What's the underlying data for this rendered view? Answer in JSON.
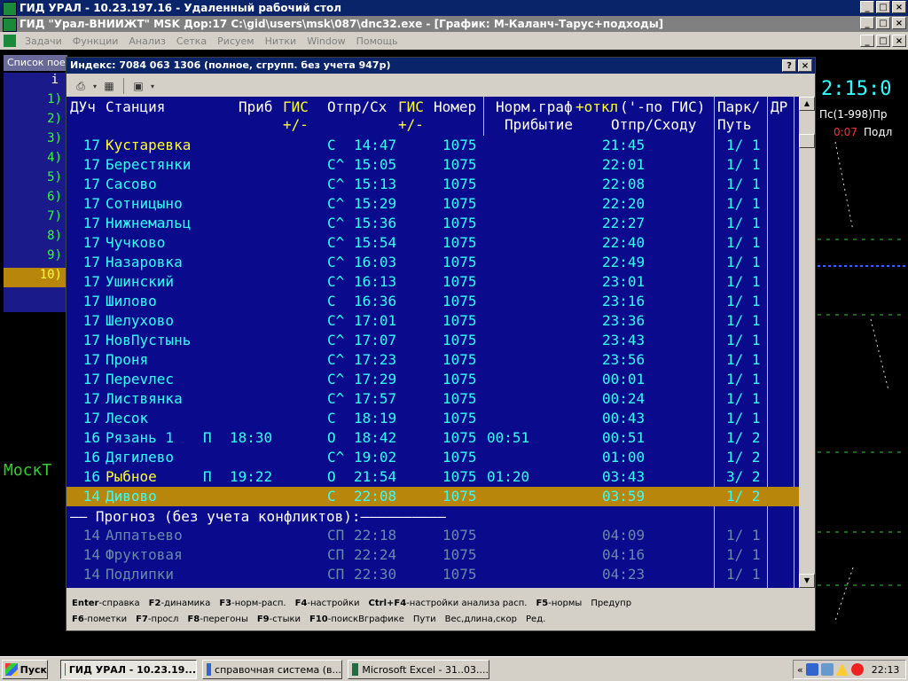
{
  "remote_title": "ГИД УРАЛ - 10.23.197.16 - Удаленный рабочий стол",
  "app_title": "ГИД \"Урал-ВНИИЖТ\" MSK Дор:17 C:\\gid\\users\\msk\\087\\dnc32.exe - [График: М-Каланч-Тарус+подходы]",
  "menu": [
    "Задачи",
    "Функции",
    "Анализ",
    "Сетка",
    "Рисуем",
    "Нитки",
    "Window",
    "Помощь"
  ],
  "window_buttons": {
    "min": "_",
    "max": "□",
    "close": "×"
  },
  "bg_list": {
    "title": "Список пое",
    "header": "i",
    "rows": [
      "1)",
      "2)",
      "3)",
      "4)",
      "5)",
      "6)",
      "7)",
      "8)",
      "9)",
      "10)"
    ]
  },
  "bg_clock": "2:15:0",
  "bg_side": {
    "line1": "Пс(1-998)Пр",
    "red_time": "0:07",
    "line2": "Подл"
  },
  "bg_label": "МоскТ",
  "dialog": {
    "title": "Индекс: 7084 063 1306 (полное, сгрупп. без учета 947р)",
    "help_btn": "?",
    "close_btn": "×"
  },
  "table": {
    "headers": {
      "du": "ДУч",
      "station": "Станция",
      "arr": "Приб",
      "gis1": "ГИС",
      "gis1b": "+/-",
      "dep": "Отпр/Сх",
      "gis2": "ГИС",
      "gis2b": "+/-",
      "num": "Номер",
      "norm": "Норм.граф",
      "otkl": "+откл",
      "pgis": "('-по ГИС)",
      "norm_arr": "Прибытие",
      "norm_dep": "Отпр/Сходу",
      "park": "Парк/",
      "put": "Путь",
      "dr": "ДР"
    },
    "rows": [
      {
        "du": "17",
        "st": "Кустаревка",
        "yel": true,
        "pr": "",
        "pt": "",
        "s": "С",
        "ot": "14:47",
        "num": "1075",
        "arr": "",
        "dep": "21:45",
        "park": "1/ 1"
      },
      {
        "du": "17",
        "st": "Берестянки",
        "yel": false,
        "pr": "",
        "pt": "",
        "s": "С^",
        "ot": "15:05",
        "num": "1075",
        "arr": "",
        "dep": "22:01",
        "park": "1/ 1"
      },
      {
        "du": "17",
        "st": "Сасово",
        "yel": false,
        "pr": "",
        "pt": "",
        "s": "С^",
        "ot": "15:13",
        "num": "1075",
        "arr": "",
        "dep": "22:08",
        "park": "1/ 1"
      },
      {
        "du": "17",
        "st": "Сотницыно",
        "yel": false,
        "pr": "",
        "pt": "",
        "s": "С^",
        "ot": "15:29",
        "num": "1075",
        "arr": "",
        "dep": "22:20",
        "park": "1/ 1"
      },
      {
        "du": "17",
        "st": "Нижнемальц",
        "yel": false,
        "pr": "",
        "pt": "",
        "s": "С^",
        "ot": "15:36",
        "num": "1075",
        "arr": "",
        "dep": "22:27",
        "park": "1/ 1"
      },
      {
        "du": "17",
        "st": "Чучково",
        "yel": false,
        "pr": "",
        "pt": "",
        "s": "С^",
        "ot": "15:54",
        "num": "1075",
        "arr": "",
        "dep": "22:40",
        "park": "1/ 1"
      },
      {
        "du": "17",
        "st": "Назаровка",
        "yel": false,
        "pr": "",
        "pt": "",
        "s": "С^",
        "ot": "16:03",
        "num": "1075",
        "arr": "",
        "dep": "22:49",
        "park": "1/ 1"
      },
      {
        "du": "17",
        "st": "Ушинский",
        "yel": false,
        "pr": "",
        "pt": "",
        "s": "С^",
        "ot": "16:13",
        "num": "1075",
        "arr": "",
        "dep": "23:01",
        "park": "1/ 1"
      },
      {
        "du": "17",
        "st": "Шилово",
        "yel": false,
        "pr": "",
        "pt": "",
        "s": "С",
        "ot": "16:36",
        "num": "1075",
        "arr": "",
        "dep": "23:16",
        "park": "1/ 1"
      },
      {
        "du": "17",
        "st": "Шелухово",
        "yel": false,
        "pr": "",
        "pt": "",
        "s": "С^",
        "ot": "17:01",
        "num": "1075",
        "arr": "",
        "dep": "23:36",
        "park": "1/ 1"
      },
      {
        "du": "17",
        "st": "НовПустынь",
        "yel": false,
        "pr": "",
        "pt": "",
        "s": "С^",
        "ot": "17:07",
        "num": "1075",
        "arr": "",
        "dep": "23:43",
        "park": "1/ 1"
      },
      {
        "du": "17",
        "st": "Проня",
        "yel": false,
        "pr": "",
        "pt": "",
        "s": "С^",
        "ot": "17:23",
        "num": "1075",
        "arr": "",
        "dep": "23:56",
        "park": "1/ 1"
      },
      {
        "du": "17",
        "st": "Переvлес",
        "yel": false,
        "pr": "",
        "pt": "",
        "s": "С^",
        "ot": "17:29",
        "num": "1075",
        "arr": "",
        "dep": "00:01",
        "park": "1/ 1"
      },
      {
        "du": "17",
        "st": "Листвянка",
        "yel": false,
        "pr": "",
        "pt": "",
        "s": "С^",
        "ot": "17:57",
        "num": "1075",
        "arr": "",
        "dep": "00:24",
        "park": "1/ 1"
      },
      {
        "du": "17",
        "st": "Лесок",
        "yel": false,
        "pr": "",
        "pt": "",
        "s": "С",
        "ot": "18:19",
        "num": "1075",
        "arr": "",
        "dep": "00:43",
        "park": "1/ 1"
      },
      {
        "du": "16",
        "st": "Рязань 1",
        "yel": false,
        "pr": "П",
        "pt": "18:30",
        "s": "О",
        "ot": "18:42",
        "num": "1075",
        "arr": "00:51",
        "dep": "00:51",
        "park": "1/ 2"
      },
      {
        "du": "16",
        "st": "Дягилево",
        "yel": false,
        "pr": "",
        "pt": "",
        "s": "С^",
        "ot": "19:02",
        "num": "1075",
        "arr": "",
        "dep": "01:00",
        "park": "1/ 2"
      },
      {
        "du": "16",
        "st": "Рыбное",
        "yel": true,
        "pr": "П",
        "pt": "19:22",
        "s": "О",
        "ot": "21:54",
        "num": "1075",
        "arr": "01:20",
        "dep": "03:43",
        "park": "3/ 2"
      },
      {
        "du": "14",
        "st": "Дивово",
        "yel": true,
        "pr": "",
        "pt": "",
        "s": "С",
        "ot": "22:08",
        "num": "1075",
        "arr": "",
        "dep": "03:59",
        "park": "1/ 2",
        "selected": true
      }
    ],
    "forecast_label": "—— Прогноз (без учета конфликтов):——————————",
    "forecast_rows": [
      {
        "du": "14",
        "st": "Алпатьево",
        "s": "СП",
        "ot": "22:18",
        "num": "1075",
        "dep": "04:09",
        "park": "1/ 1"
      },
      {
        "du": "14",
        "st": "Фруктовая",
        "s": "СП",
        "ot": "22:24",
        "num": "1075",
        "dep": "04:16",
        "park": "1/ 1"
      },
      {
        "du": "14",
        "st": "Подлипки",
        "s": "СП",
        "ot": "22:30",
        "num": "1075",
        "dep": "04:23",
        "park": "1/ 1"
      }
    ]
  },
  "hotkeys": {
    "line1": [
      {
        "k": "Enter",
        "t": "-справка"
      },
      {
        "k": "F2",
        "t": "-динамика"
      },
      {
        "k": "F3",
        "t": "-норм-расп."
      },
      {
        "k": "F4",
        "t": "-настройки"
      },
      {
        "k": "Ctrl+F4",
        "t": "-настройки анализа расп."
      },
      {
        "k": "F5",
        "t": "-нормы"
      },
      {
        "k": "",
        "t": "Предупр"
      }
    ],
    "line2": [
      {
        "k": "F6",
        "t": "-пометки"
      },
      {
        "k": "F7",
        "t": "-просл"
      },
      {
        "k": "F8",
        "t": "-перегоны"
      },
      {
        "k": "F9",
        "t": "-стыки"
      },
      {
        "k": "F10",
        "t": "-поискВграфике"
      },
      {
        "k": "",
        "t": "Пути"
      },
      {
        "k": "",
        "t": "Вес,длина,скор"
      },
      {
        "k": "",
        "t": "Ред."
      }
    ]
  },
  "taskbar": {
    "start": "Пуск",
    "tasks": [
      "ГИД УРАЛ - 10.23.19...",
      "справочная система (в...",
      "Microsoft Excel - 31..03...."
    ],
    "time": "22:13",
    "tray_arrow": "«"
  }
}
